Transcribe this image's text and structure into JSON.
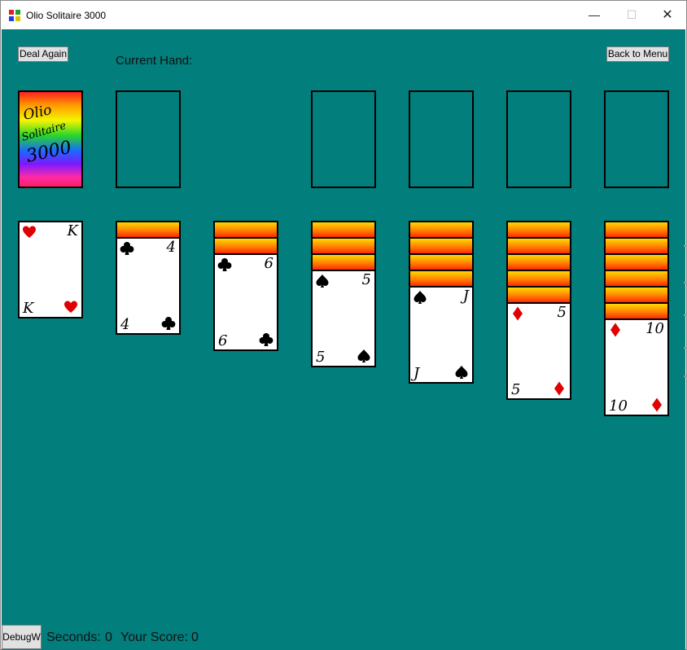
{
  "window": {
    "title": "Olio Solitaire 3000",
    "minimize": "—",
    "maximize": "☐",
    "close": "✕"
  },
  "toolbar": {
    "deal_again": "Deal Again",
    "current_hand_label": "Current Hand:",
    "back_to_menu": "Back to Menu"
  },
  "deck": {
    "logo_text": "Olio Solitaire 3000"
  },
  "tableau": [
    {
      "hidden": 0,
      "rank": "K",
      "suit": "heart"
    },
    {
      "hidden": 1,
      "rank": "4",
      "suit": "club"
    },
    {
      "hidden": 2,
      "rank": "6",
      "suit": "club"
    },
    {
      "hidden": 3,
      "rank": "5",
      "suit": "spade"
    },
    {
      "hidden": 4,
      "rank": "J",
      "suit": "spade"
    },
    {
      "hidden": 5,
      "rank": "5",
      "suit": "diamond"
    },
    {
      "hidden": 6,
      "rank": "10",
      "suit": "diamond"
    }
  ],
  "footer": {
    "debug_button": "DebugW",
    "seconds_label": "Seconds:",
    "seconds_value": "0",
    "score_label": "Your Score:",
    "score_value": "0"
  },
  "colors": {
    "table": "#027e7c",
    "red_suit": "#e00000",
    "black_suit": "#000000"
  }
}
